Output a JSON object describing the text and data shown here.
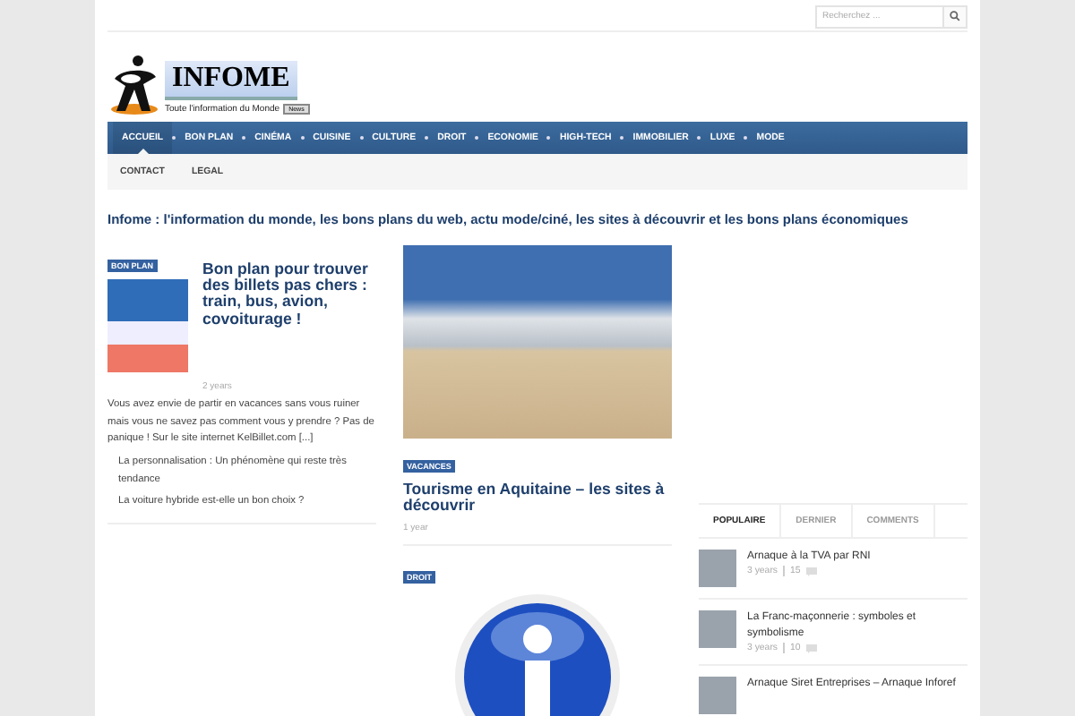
{
  "search": {
    "placeholder": "Recherchez ..."
  },
  "logo": {
    "title": "INFOME",
    "tagline": "Toute l'information du Monde",
    "badge": "News"
  },
  "nav": [
    {
      "label": "ACCUEIL",
      "selected": true
    },
    {
      "label": "BON PLAN",
      "selected": false
    },
    {
      "label": "CINÉMA",
      "selected": false
    },
    {
      "label": "CUISINE",
      "selected": false
    },
    {
      "label": "CULTURE",
      "selected": false
    },
    {
      "label": "DROIT",
      "selected": false
    },
    {
      "label": "ECONOMIE",
      "selected": false
    },
    {
      "label": "HIGH-TECH",
      "selected": false
    },
    {
      "label": "IMMOBILIER",
      "selected": false
    },
    {
      "label": "LUXE",
      "selected": false
    },
    {
      "label": "MODE",
      "selected": false
    }
  ],
  "subnav": [
    "CONTACT",
    "LEGAL"
  ],
  "tagline": "Infome : l'information du monde, les bons plans du web, actu mode/ciné, les sites à découvrir et les bons plans économiques",
  "featured": {
    "tag": "BON PLAN",
    "title": "Bon plan pour trouver des billets pas chers : train, bus, avion, covoiturage !",
    "age": "2 years",
    "excerpt": "Vous avez envie de partir en vacances sans vous ruiner mais vous ne savez pas comment vous y prendre ? Pas de panique ! Sur le site internet KelBillet.com [...]",
    "related": [
      "La personnalisation : Un phénomène qui reste très tendance",
      "La voiture hybride est-elle un bon choix ?"
    ]
  },
  "middle": [
    {
      "kind": "photo",
      "tag": "VACANCES",
      "title": "Tourisme en Aquitaine – les sites à découvrir",
      "age": "1 year"
    },
    {
      "kind": "icon",
      "tag": "DROIT"
    }
  ],
  "sidebar": {
    "tabs": [
      {
        "label": "POPULAIRE",
        "selected": true
      },
      {
        "label": "DERNIER",
        "selected": false
      },
      {
        "label": "COMMENTS",
        "selected": false
      }
    ],
    "posts": [
      {
        "title": "Arnaque à la TVA par RNI",
        "age": "3 years",
        "comments": "15"
      },
      {
        "title": "La Franc-maçonnerie : symboles et symbolisme",
        "age": "3 years",
        "comments": "10"
      },
      {
        "title": "Arnaque Siret Entreprises – Arnaque Inforef"
      }
    ]
  }
}
